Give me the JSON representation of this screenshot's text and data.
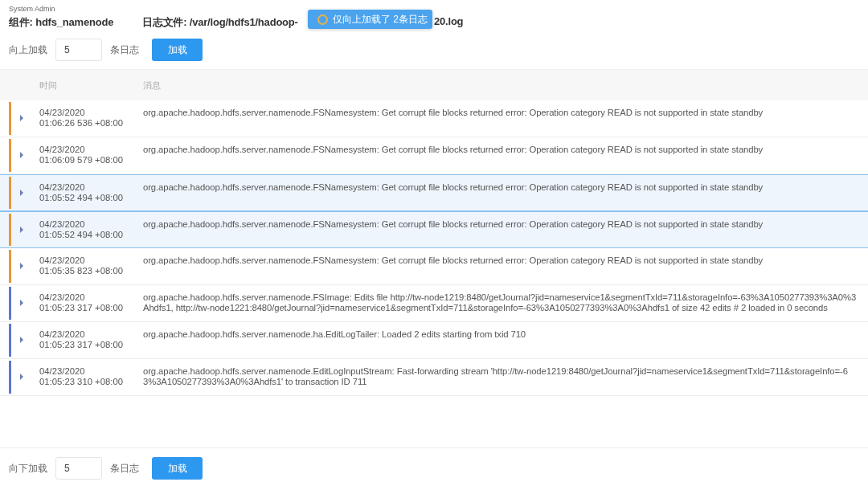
{
  "app_name": "System Admin",
  "component": "组件: hdfs_namenode",
  "file_path_start": "日志文件: /var/log/hdfs1/hadoop-",
  "file_path_end": "20.log",
  "toast": {
    "text": "仅向上加载了 2条日志"
  },
  "top_loader": {
    "label": "向上加载",
    "value": "5",
    "unit": "条日志",
    "button": "加载"
  },
  "table": {
    "columns": [
      "时间",
      "消息"
    ],
    "rows": [
      {
        "color": "#e8973a",
        "selected": false,
        "date": "04/23/2020",
        "time": "01:06:26 536 +08:00",
        "message": "org.apache.hadoop.hdfs.server.namenode.FSNamesystem: Get corrupt file blocks returned error: Operation category READ is not supported in state standby"
      },
      {
        "color": "#e8973a",
        "selected": false,
        "date": "04/23/2020",
        "time": "01:06:09 579 +08:00",
        "message": "org.apache.hadoop.hdfs.server.namenode.FSNamesystem: Get corrupt file blocks returned error: Operation category READ is not supported in state standby"
      },
      {
        "color": "#e8973a",
        "selected": true,
        "date": "04/23/2020",
        "time": "01:05:52 494 +08:00",
        "message": "org.apache.hadoop.hdfs.server.namenode.FSNamesystem: Get corrupt file blocks returned error: Operation category READ is not supported in state standby"
      },
      {
        "color": "#e8973a",
        "selected": true,
        "date": "04/23/2020",
        "time": "01:05:52 494 +08:00",
        "message": "org.apache.hadoop.hdfs.server.namenode.FSNamesystem: Get corrupt file blocks returned error: Operation category READ is not supported in state standby"
      },
      {
        "color": "#e8973a",
        "selected": false,
        "date": "04/23/2020",
        "time": "01:05:35 823 +08:00",
        "message": "org.apache.hadoop.hdfs.server.namenode.FSNamesystem: Get corrupt file blocks returned error: Operation category READ is not supported in state standby"
      },
      {
        "color": "#5b78d0",
        "selected": false,
        "date": "04/23/2020",
        "time": "01:05:23 317 +08:00",
        "message": "org.apache.hadoop.hdfs.server.namenode.FSImage: Edits file http://tw-node1219:8480/getJournal?jid=nameservice1&segmentTxId=711&storageInfo=-63%3A1050277393%3A0%3Ahdfs1, http://tw-node1221:8480/getJournal?jid=nameservice1&segmentTxId=711&storageInfo=-63%3A1050277393%3A0%3Ahdfs1 of size 42 edits # 2 loaded in 0 seconds"
      },
      {
        "color": "#5b78d0",
        "selected": false,
        "date": "04/23/2020",
        "time": "01:05:23 317 +08:00",
        "message": "org.apache.hadoop.hdfs.server.namenode.ha.EditLogTailer: Loaded 2 edits starting from txid 710"
      },
      {
        "color": "#5b78d0",
        "selected": false,
        "date": "04/23/2020",
        "time": "01:05:23 310 +08:00",
        "message": "org.apache.hadoop.hdfs.server.namenode.EditLogInputStream: Fast-forwarding stream 'http://tw-node1219:8480/getJournal?jid=nameservice1&segmentTxId=711&storageInfo=-63%3A1050277393%3A0%3Ahdfs1' to transaction ID 711"
      }
    ]
  },
  "bottom_loader": {
    "label": "向下加载",
    "value": "5",
    "unit": "条日志",
    "button": "加载"
  }
}
